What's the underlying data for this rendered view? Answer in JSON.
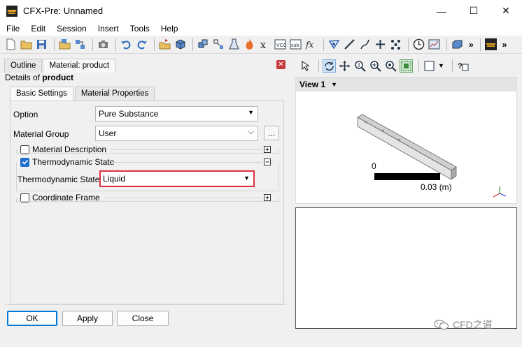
{
  "window": {
    "title": "CFX-Pre:  Unnamed",
    "minimize": "—",
    "maximize": "☐",
    "close": "✕"
  },
  "menu": [
    "File",
    "Edit",
    "Session",
    "Insert",
    "Tools",
    "Help"
  ],
  "panel": {
    "tabs": [
      "Outline",
      "Material: product"
    ],
    "details_prefix": "Details of",
    "details_name": "product",
    "sub_tabs": [
      "Basic Settings",
      "Material Properties"
    ],
    "option_label": "Option",
    "option_value": "Pure Substance",
    "material_group_label": "Material Group",
    "material_group_value": "User",
    "ellipsis": "...",
    "material_description": "Material Description",
    "thermodynamic_state_group": "Thermodynamic State",
    "thermodynamic_state_label": "Thermodynamic State",
    "thermodynamic_state_value": "Liquid",
    "coordinate_frame": "Coordinate Frame",
    "expand": "+",
    "collapse": "−",
    "ok": "OK",
    "apply": "Apply",
    "close_btn": "Close"
  },
  "viewport": {
    "view_label": "View 1",
    "scale_start": "0",
    "scale_end": "0.03  (m)",
    "axes": [
      "x",
      "y",
      "z"
    ]
  },
  "watermark": "CFD之道"
}
